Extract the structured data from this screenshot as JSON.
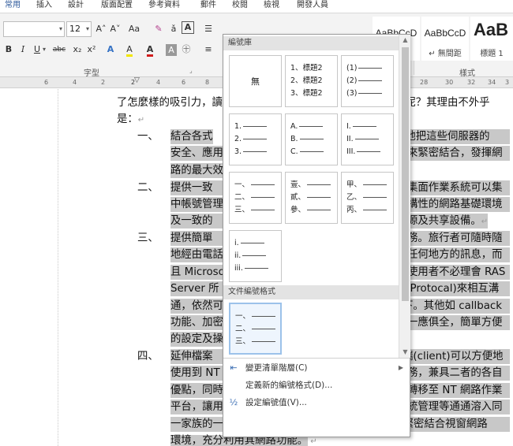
{
  "ribbon": {
    "tabs": [
      "常用",
      "插入",
      "設計",
      "版面配置",
      "參考資料",
      "郵件",
      "校閱",
      "檢視",
      "開發人員"
    ],
    "font_name": "",
    "font_size": "12",
    "grow_font": "A˄",
    "shrink_font": "A˅",
    "change_case": "Aa",
    "bold": "B",
    "italic": "I",
    "underline": "U",
    "strike": "abc",
    "subscript": "x₂",
    "superscript": "x²",
    "font_color": "A",
    "highlight": "A",
    "group_font": "字型",
    "group_styles": "樣式",
    "styles": [
      {
        "sample": "AaBbCcD",
        "name": "↵ 內文"
      },
      {
        "sample": "AaBbCcD",
        "name": "↵ 無間距"
      },
      {
        "sample": "AaB",
        "name": "標題 1"
      }
    ]
  },
  "ruler": {
    "left_ticks": [
      "6",
      "4",
      "2",
      "2",
      "4",
      "6",
      "8"
    ],
    "right_ticks": [
      "28",
      "30",
      "32",
      "34",
      "3"
    ]
  },
  "document": {
    "lines": [
      "了怎麼樣的吸引力，讀",
      "路呢？其理由不外乎",
      "是：",
      "一、",
      "結合各式",
      "然地把這些伺服器的",
      "安全、應用",
      "來緊密結合，發揮網",
      "路的最大效",
      "二、",
      "提供一致",
      "集面作業系統可以集",
      "中帳號管理",
      "構性的網路基礎環境",
      "及一致的",
      "源及共享設備。",
      "三、",
      "提供簡單",
      "務。旅行者可隨時隨",
      "地經由電話",
      "任何地方的訊息，而",
      "且 Microso",
      "使用者不必理會 RAS",
      "Server 所",
      "t Protocal)來相互溝",
      "通，依然可",
      "下。其他如 callback",
      "功能、加密",
      "一應俱全，簡單方便",
      "的設定及操",
      "四、",
      "延伸檔案",
      "端(client)可以方便地",
      "使用到 NT",
      "務，兼具二者的各自",
      "優點，同時",
      "轉移至 NT 網路作業",
      "平台，讓用",
      "統管理等通通溶入同",
      "一家族的一致環境中，架構出共同的使用介面，以緊密結合視窗網路",
      "環境，充分利用其網路功能。"
    ]
  },
  "gallery": {
    "library_header": "編號庫",
    "document_header": "文件編號格式",
    "none_label": "無",
    "tiles": [
      {
        "lines": [
          "1、標題2",
          "2、標題2",
          "3、標題2"
        ]
      },
      {
        "lines": [
          "(1)",
          "(2)",
          "(3)"
        ]
      },
      {
        "lines": [
          "1.",
          "2.",
          "3."
        ]
      },
      {
        "lines": [
          "A.",
          "B.",
          "C."
        ]
      },
      {
        "lines": [
          "I.",
          "II.",
          "III."
        ]
      },
      {
        "lines": [
          "一、",
          "二、",
          "三、"
        ]
      },
      {
        "lines": [
          "壹、",
          "貳、",
          "參、"
        ]
      },
      {
        "lines": [
          "甲、",
          "乙、",
          "丙、"
        ]
      },
      {
        "lines": [
          "i.",
          "ii.",
          "iii."
        ]
      }
    ],
    "document_tile": {
      "lines": [
        "一、",
        "二、",
        "三、"
      ]
    },
    "menu": [
      {
        "label": "變更清單階層(C)",
        "icon": "indent-level-icon",
        "arrow": "▶"
      },
      {
        "label": "定義新的編號格式(D)...",
        "icon": "",
        "arrow": ""
      },
      {
        "label": "設定編號值(V)...",
        "icon": "set-value-icon",
        "arrow": ""
      }
    ]
  }
}
